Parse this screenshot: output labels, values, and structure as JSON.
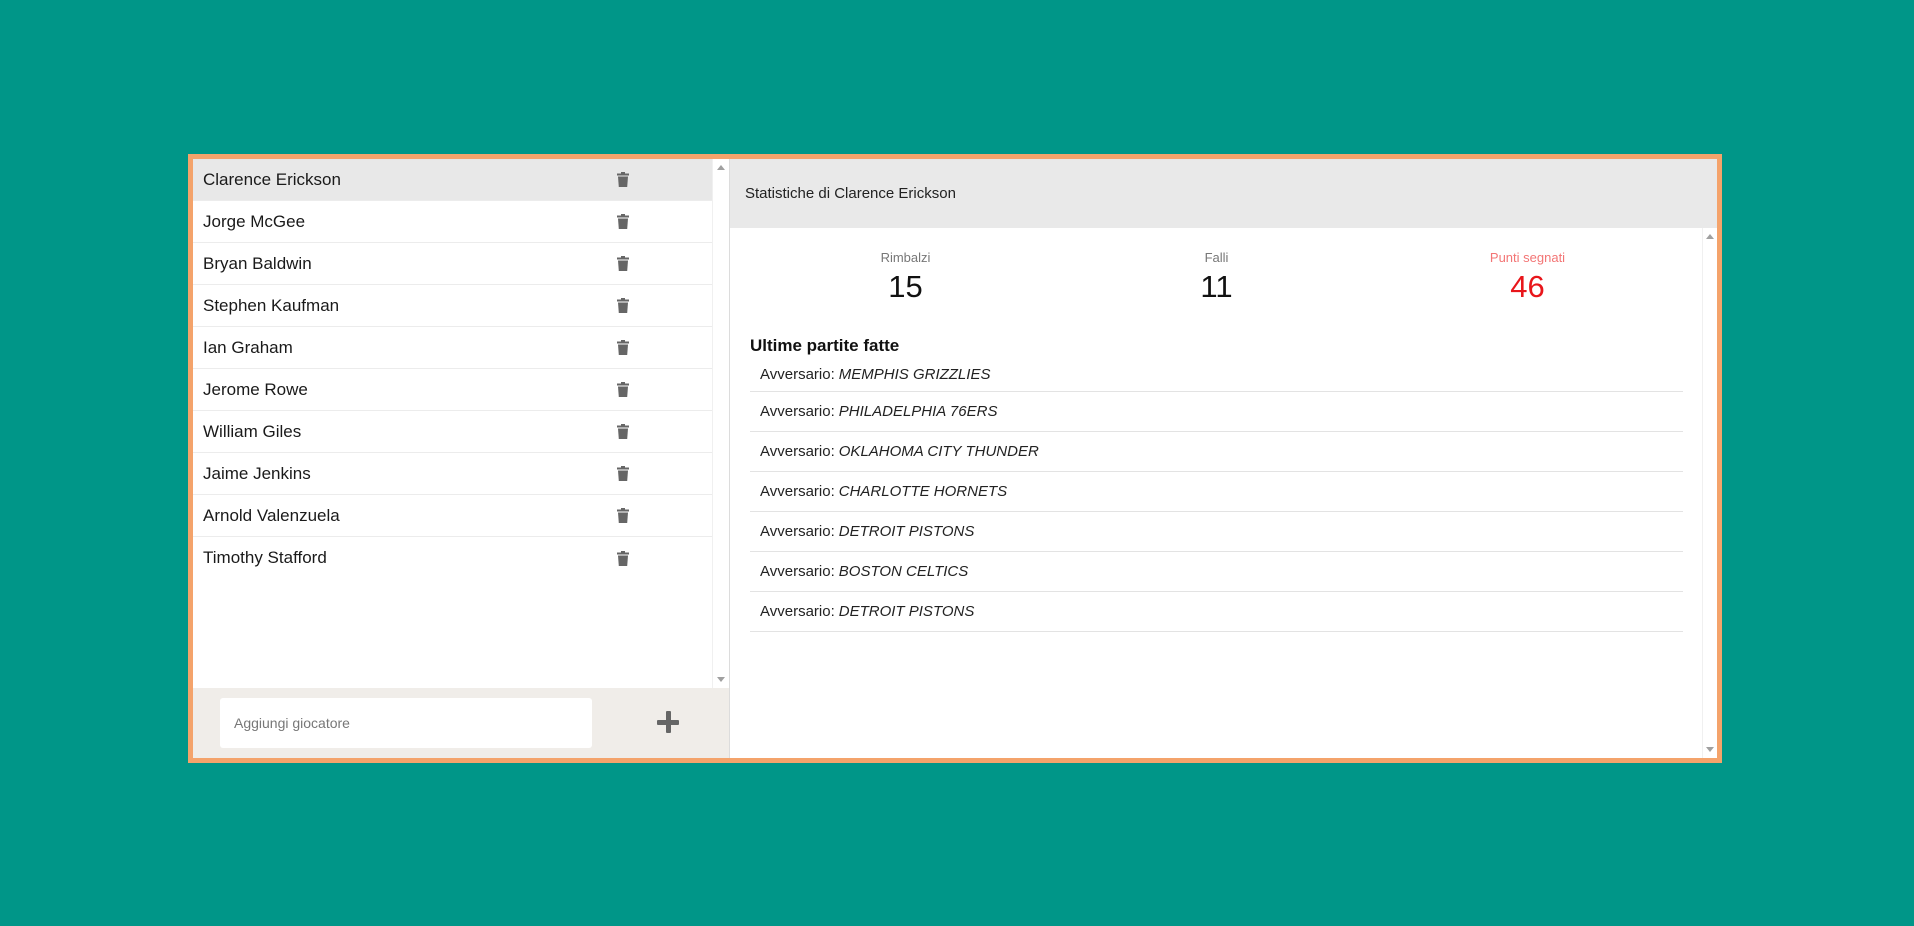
{
  "players": [
    {
      "name": "Clarence Erickson",
      "selected": true
    },
    {
      "name": "Jorge McGee"
    },
    {
      "name": "Bryan Baldwin"
    },
    {
      "name": "Stephen Kaufman"
    },
    {
      "name": "Ian Graham"
    },
    {
      "name": "Jerome Rowe"
    },
    {
      "name": "William Giles"
    },
    {
      "name": "Jaime Jenkins"
    },
    {
      "name": "Arnold Valenzuela"
    },
    {
      "name": "Timothy Stafford"
    }
  ],
  "add_player": {
    "placeholder": "Aggiungi giocatore",
    "value": ""
  },
  "stats_panel": {
    "header": "Statistiche di Clarence Erickson",
    "stats": [
      {
        "label": "Rimbalzi",
        "value": "15"
      },
      {
        "label": "Falli",
        "value": "11"
      },
      {
        "label": "Punti segnati",
        "value": "46"
      }
    ],
    "games_title": "Ultime partite fatte",
    "opponent_label": "Avversario:",
    "games": [
      "MEMPHIS GRIZZLIES",
      "PHILADELPHIA 76ERS",
      "OKLAHOMA CITY THUNDER",
      "CHARLOTTE HORNETS",
      "DETROIT PISTONS",
      "BOSTON CELTICS",
      "DETROIT PISTONS"
    ]
  },
  "colors": {
    "background": "#009688",
    "frame_border": "#f4a36b",
    "highlight_value": "#e8161b",
    "highlight_label": "#f37575"
  },
  "icons": {
    "delete": "trash-icon",
    "add": "plus-icon"
  }
}
